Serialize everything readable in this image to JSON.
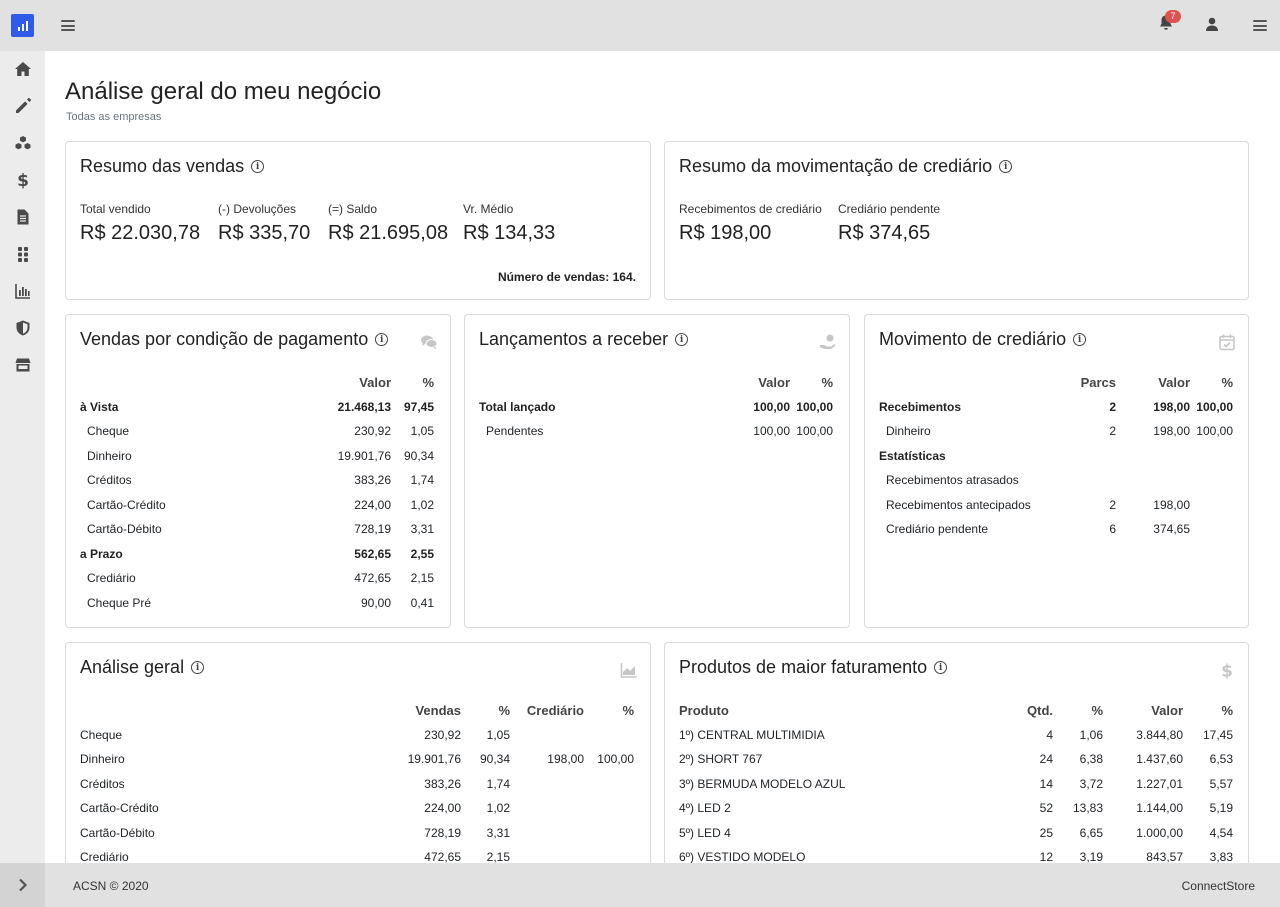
{
  "header": {
    "notifications_count": "7"
  },
  "page": {
    "title": "Análise geral do meu negócio",
    "subtitle": "Todas as empresas"
  },
  "footer": {
    "left": "ACSN © 2020",
    "right": "ConnectStore"
  },
  "sidebar_icons": [
    "home-icon",
    "pencil-icon",
    "cubes-icon",
    "dollar-icon",
    "document-icon",
    "grid-icon",
    "bar-chart-icon",
    "shield-icon",
    "store-icon"
  ],
  "resumo_vendas": {
    "title": "Resumo das vendas",
    "kpis": [
      {
        "label": "Total vendido",
        "value": "R$ 22.030,78"
      },
      {
        "label": "(-) Devoluções",
        "value": "R$ 335,70"
      },
      {
        "label": "(=) Saldo",
        "value": "R$ 21.695,08"
      },
      {
        "label": "Vr. Médio",
        "value": "R$ 134,33"
      }
    ],
    "count_text": "Número de vendas: 164."
  },
  "resumo_crediario": {
    "title": "Resumo da movimentação de crediário",
    "kpis": [
      {
        "label": "Recebimentos de crediário",
        "value": "R$ 198,00"
      },
      {
        "label": "Crediário pendente",
        "value": "R$ 374,65"
      }
    ]
  },
  "vendas_pagamento": {
    "title": "Vendas por condição de pagamento",
    "headers": [
      "Valor",
      "%"
    ],
    "rows": [
      {
        "label": "à Vista",
        "valor": "21.468,13",
        "pct": "97,45",
        "bold": true
      },
      {
        "label": "Cheque",
        "valor": "230,92",
        "pct": "1,05"
      },
      {
        "label": "Dinheiro",
        "valor": "19.901,76",
        "pct": "90,34"
      },
      {
        "label": "Créditos",
        "valor": "383,26",
        "pct": "1,74"
      },
      {
        "label": "Cartão-Crédito",
        "valor": "224,00",
        "pct": "1,02"
      },
      {
        "label": "Cartão-Débito",
        "valor": "728,19",
        "pct": "3,31"
      },
      {
        "label": "a Prazo",
        "valor": "562,65",
        "pct": "2,55",
        "bold": true
      },
      {
        "label": "Crediário",
        "valor": "472,65",
        "pct": "2,15"
      },
      {
        "label": "Cheque Pré",
        "valor": "90,00",
        "pct": "0,41"
      }
    ]
  },
  "lancamentos": {
    "title": "Lançamentos a receber",
    "headers": [
      "Valor",
      "%"
    ],
    "rows": [
      {
        "label": "Total lançado",
        "valor": "100,00",
        "pct": "100,00",
        "bold": true
      },
      {
        "label": "Pendentes",
        "valor": "100,00",
        "pct": "100,00"
      }
    ]
  },
  "movimento_crediario": {
    "title": "Movimento de crediário",
    "headers": [
      "Parcs",
      "Valor",
      "%"
    ],
    "rows": [
      {
        "label": "Recebimentos",
        "parcs": "2",
        "valor": "198,00",
        "pct": "100,00",
        "bold": true
      },
      {
        "label": "Dinheiro",
        "parcs": "2",
        "valor": "198,00",
        "pct": "100,00"
      },
      {
        "label": "Estatísticas",
        "parcs": "",
        "valor": "",
        "pct": "",
        "bold": true
      },
      {
        "label": "Recebimentos atrasados",
        "parcs": "",
        "valor": "",
        "pct": ""
      },
      {
        "label": "Recebimentos antecipados",
        "parcs": "2",
        "valor": "198,00",
        "pct": ""
      },
      {
        "label": "Crediário pendente",
        "parcs": "6",
        "valor": "374,65",
        "pct": ""
      }
    ]
  },
  "analise_geral": {
    "title": "Análise geral",
    "headers": [
      "Vendas",
      "%",
      "Crediário",
      "%"
    ],
    "rows": [
      {
        "label": "Cheque",
        "vendas": "230,92",
        "pct": "1,05",
        "crediario": "",
        "pct2": ""
      },
      {
        "label": "Dinheiro",
        "vendas": "19.901,76",
        "pct": "90,34",
        "crediario": "198,00",
        "pct2": "100,00"
      },
      {
        "label": "Créditos",
        "vendas": "383,26",
        "pct": "1,74",
        "crediario": "",
        "pct2": ""
      },
      {
        "label": "Cartão-Crédito",
        "vendas": "224,00",
        "pct": "1,02",
        "crediario": "",
        "pct2": ""
      },
      {
        "label": "Cartão-Débito",
        "vendas": "728,19",
        "pct": "3,31",
        "crediario": "",
        "pct2": ""
      },
      {
        "label": "Crediário",
        "vendas": "472,65",
        "pct": "2,15",
        "crediario": "",
        "pct2": ""
      }
    ]
  },
  "produtos": {
    "title": "Produtos de maior faturamento",
    "headers": [
      "Produto",
      "Qtd.",
      "%",
      "Valor",
      "%"
    ],
    "rows": [
      {
        "produto": "1º) CENTRAL MULTIMIDIA",
        "qtd": "4",
        "pct": "1,06",
        "valor": "3.844,80",
        "pct2": "17,45"
      },
      {
        "produto": "2º) SHORT 767",
        "qtd": "24",
        "pct": "6,38",
        "valor": "1.437,60",
        "pct2": "6,53"
      },
      {
        "produto": "3º) BERMUDA MODELO AZUL",
        "qtd": "14",
        "pct": "3,72",
        "valor": "1.227,01",
        "pct2": "5,57"
      },
      {
        "produto": "4º) LED 2",
        "qtd": "52",
        "pct": "13,83",
        "valor": "1.144,00",
        "pct2": "5,19"
      },
      {
        "produto": "5º) LED 4",
        "qtd": "25",
        "pct": "6,65",
        "valor": "1.000,00",
        "pct2": "4,54"
      },
      {
        "produto": "6º) VESTIDO MODELO",
        "qtd": "12",
        "pct": "3,19",
        "valor": "843,57",
        "pct2": "3,83"
      }
    ]
  }
}
